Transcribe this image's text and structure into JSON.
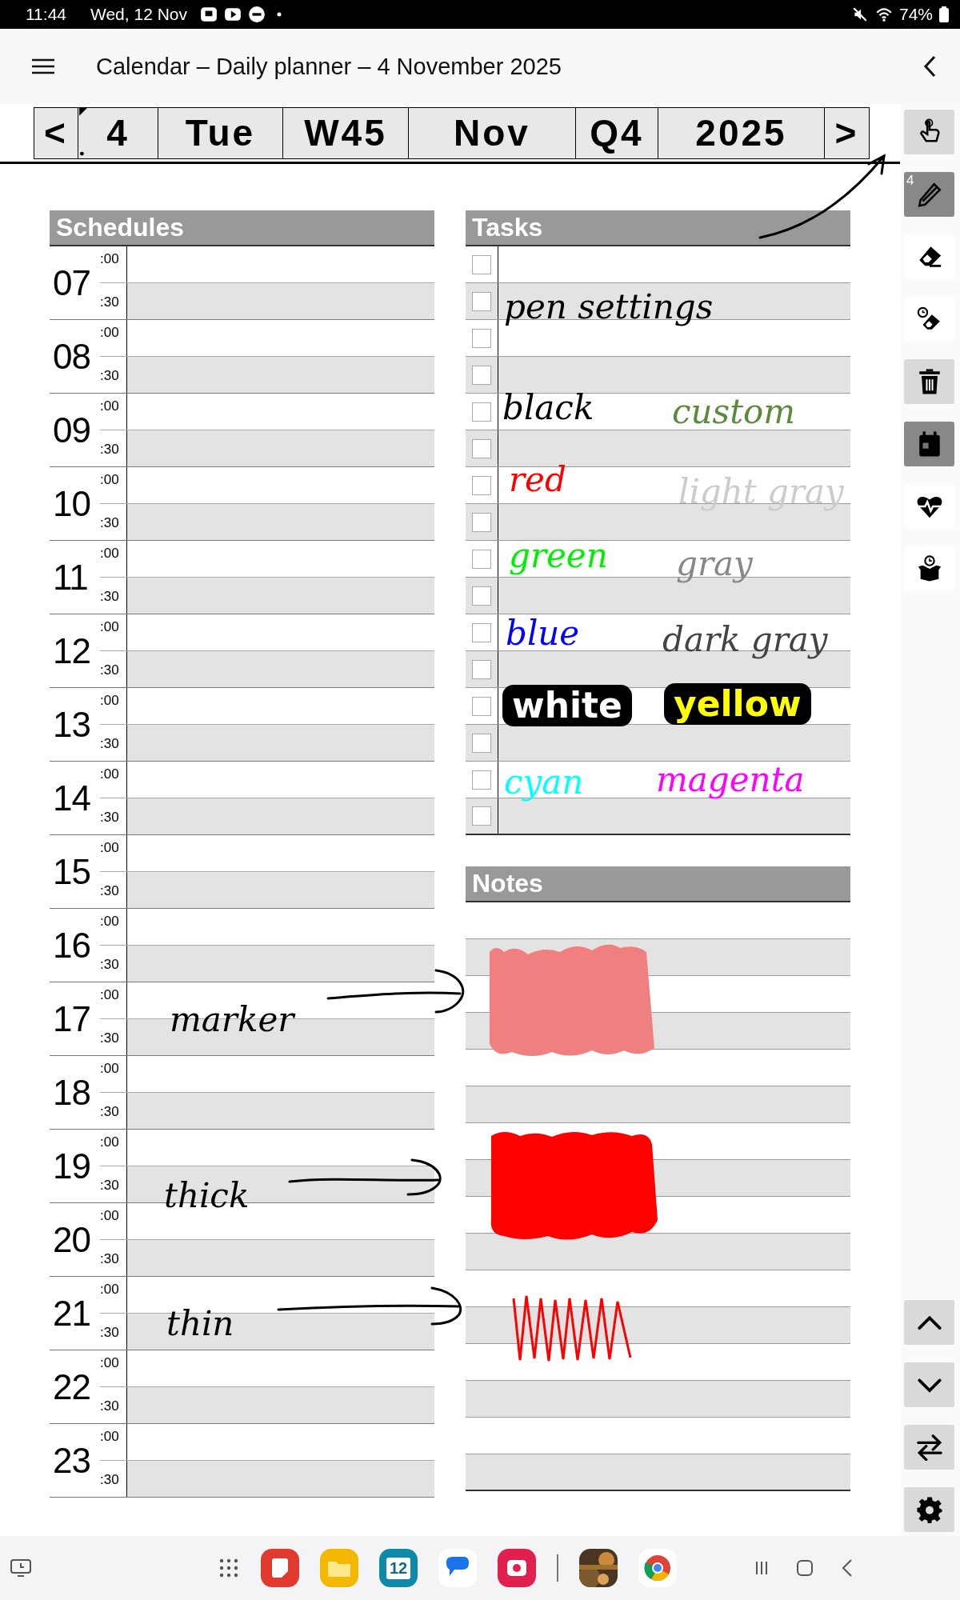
{
  "status_bar": {
    "time": "11:44",
    "date": "Wed, 12 Nov",
    "battery": "74%"
  },
  "app_bar": {
    "title": "Calendar – Daily planner – 4 November 2025"
  },
  "date_nav": {
    "prev": "<",
    "cells": [
      "4",
      "Tue",
      "W45",
      "Nov",
      "Q4",
      "2025"
    ],
    "next": ">"
  },
  "schedules": {
    "title": "Schedules",
    "hours": [
      {
        "hour": "07",
        "top": ":00",
        "bottom": ":30"
      },
      {
        "hour": "08",
        "top": ":00",
        "bottom": ":30"
      },
      {
        "hour": "09",
        "top": ":00",
        "bottom": ":30"
      },
      {
        "hour": "10",
        "top": ":00",
        "bottom": ":30"
      },
      {
        "hour": "11",
        "top": ":00",
        "bottom": ":30"
      },
      {
        "hour": "12",
        "top": ":00",
        "bottom": ":30"
      },
      {
        "hour": "13",
        "top": ":00",
        "bottom": ":30"
      },
      {
        "hour": "14",
        "top": ":00",
        "bottom": ":30"
      },
      {
        "hour": "15",
        "top": ":00",
        "bottom": ":30"
      },
      {
        "hour": "16",
        "top": ":00",
        "bottom": ":30"
      },
      {
        "hour": "17",
        "top": ":00",
        "bottom": ":30"
      },
      {
        "hour": "18",
        "top": ":00",
        "bottom": ":30"
      },
      {
        "hour": "19",
        "top": ":00",
        "bottom": ":30"
      },
      {
        "hour": "20",
        "top": ":00",
        "bottom": ":30"
      },
      {
        "hour": "21",
        "top": ":00",
        "bottom": ":30"
      },
      {
        "hour": "22",
        "top": ":00",
        "bottom": ":30"
      },
      {
        "hour": "23",
        "top": ":00",
        "bottom": ":30"
      }
    ]
  },
  "tasks": {
    "title": "Tasks",
    "rows": [
      {
        "checked": false
      },
      {
        "checked": false
      },
      {
        "checked": false
      },
      {
        "checked": false
      },
      {
        "checked": false
      },
      {
        "checked": false
      },
      {
        "checked": false
      },
      {
        "checked": false
      },
      {
        "checked": false
      },
      {
        "checked": false
      },
      {
        "checked": false
      },
      {
        "checked": false
      },
      {
        "checked": false
      },
      {
        "checked": false
      },
      {
        "checked": false
      },
      {
        "checked": false
      }
    ]
  },
  "notes": {
    "title": "Notes"
  },
  "ink": [
    {
      "text": "pen settings",
      "color": "#000000",
      "kind": "plain"
    },
    {
      "text": "black",
      "color": "#000000",
      "kind": "plain"
    },
    {
      "text": "custom",
      "color": "#5a8a3a",
      "kind": "plain"
    },
    {
      "text": "red",
      "color": "#ff0000",
      "kind": "plain"
    },
    {
      "text": "light gray",
      "color": "#cccccc",
      "kind": "plain"
    },
    {
      "text": "green",
      "color": "#00ee00",
      "kind": "plain"
    },
    {
      "text": "gray",
      "color": "#888888",
      "kind": "plain"
    },
    {
      "text": "blue",
      "color": "#0000ff",
      "kind": "plain"
    },
    {
      "text": "dark gray",
      "color": "#444444",
      "kind": "plain"
    },
    {
      "text": "white",
      "color": "#ffffff",
      "kind": "highlighted"
    },
    {
      "text": "yellow",
      "color": "#ffff00",
      "kind": "highlighted"
    },
    {
      "text": "cyan",
      "color": "#00ffff",
      "kind": "plain"
    },
    {
      "text": "magenta",
      "color": "#ff00ff",
      "kind": "plain"
    },
    {
      "text": "marker",
      "color": "#000000",
      "kind": "plain"
    },
    {
      "text": "thick",
      "color": "#000000",
      "kind": "plain"
    },
    {
      "text": "thin",
      "color": "#000000",
      "kind": "plain"
    }
  ],
  "toolbar": {
    "tools": [
      {
        "kind": "touch",
        "selected": false,
        "shaded": true
      },
      {
        "kind": "pen",
        "selected": true,
        "shaded": false,
        "badge": "4"
      },
      {
        "kind": "eraser",
        "selected": false,
        "shaded": false
      },
      {
        "kind": "timed-eraser",
        "selected": false,
        "shaded": false
      },
      {
        "kind": "trash",
        "selected": false,
        "shaded": true
      },
      {
        "kind": "calendar",
        "selected": true,
        "shaded": false
      },
      {
        "kind": "health",
        "selected": false,
        "shaded": false
      },
      {
        "kind": "box",
        "selected": false,
        "shaded": false
      }
    ],
    "bottom": [
      {
        "kind": "up"
      },
      {
        "kind": "down"
      },
      {
        "kind": "swap"
      },
      {
        "kind": "settings"
      }
    ]
  },
  "nav_bar": {
    "apps": [
      {
        "kind": "notes"
      },
      {
        "kind": "files"
      },
      {
        "kind": "calendar",
        "label": "12"
      },
      {
        "kind": "messages"
      },
      {
        "kind": "camera"
      },
      {
        "kind": "game"
      },
      {
        "kind": "browser"
      }
    ]
  }
}
